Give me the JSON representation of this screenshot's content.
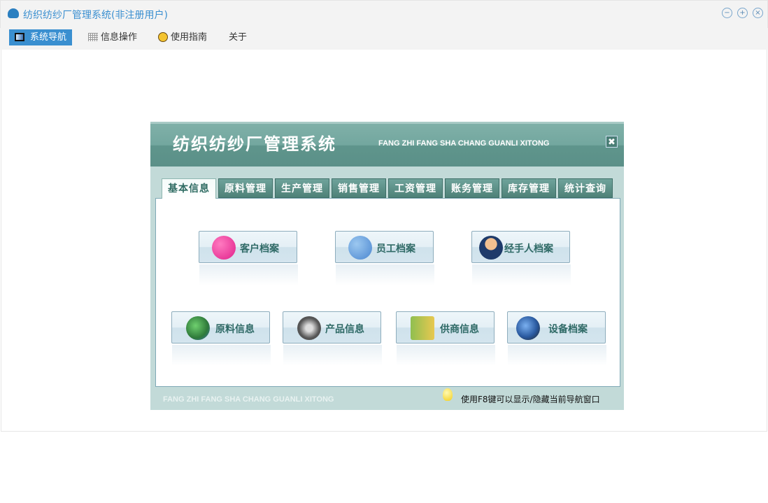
{
  "window": {
    "title": "纺织纺纱厂管理系统(非注册用户)",
    "controls": [
      "minimize",
      "maximize",
      "close"
    ]
  },
  "menu": [
    {
      "label": "系统导航",
      "icon": "monitor-icon"
    },
    {
      "label": "信息操作",
      "icon": "grid-icon"
    },
    {
      "label": "使用指南",
      "icon": "help-icon"
    },
    {
      "label": "关于"
    }
  ],
  "panel": {
    "title": "纺织纺纱厂管理系统",
    "subtitle": "FANG ZHI FANG SHA CHANG GUANLI XITONG",
    "close": "✖",
    "tabs": [
      "基本信息",
      "原料管理",
      "生产管理",
      "销售管理",
      "工资管理",
      "账务管理",
      "库存管理",
      "统计查询"
    ],
    "buttons": [
      {
        "label": "客户档案",
        "color": "#e0208a"
      },
      {
        "label": "员工档案",
        "color": "#4a86d0"
      },
      {
        "label": "经手人档案",
        "color": "#1e3a6a"
      },
      {
        "label": "原料信息",
        "color": "#2f7a3a"
      },
      {
        "label": "产品信息",
        "color": "#555555"
      },
      {
        "label": "供商信息",
        "color": "#c8a830"
      },
      {
        "label": "设备档案",
        "color": "#2a5aa0"
      }
    ],
    "footer_en": "FANG ZHI FANG SHA CHANG GUANLI XITONG",
    "footer_tip": "使用F8键可以显示/隐藏当前导航窗口"
  }
}
